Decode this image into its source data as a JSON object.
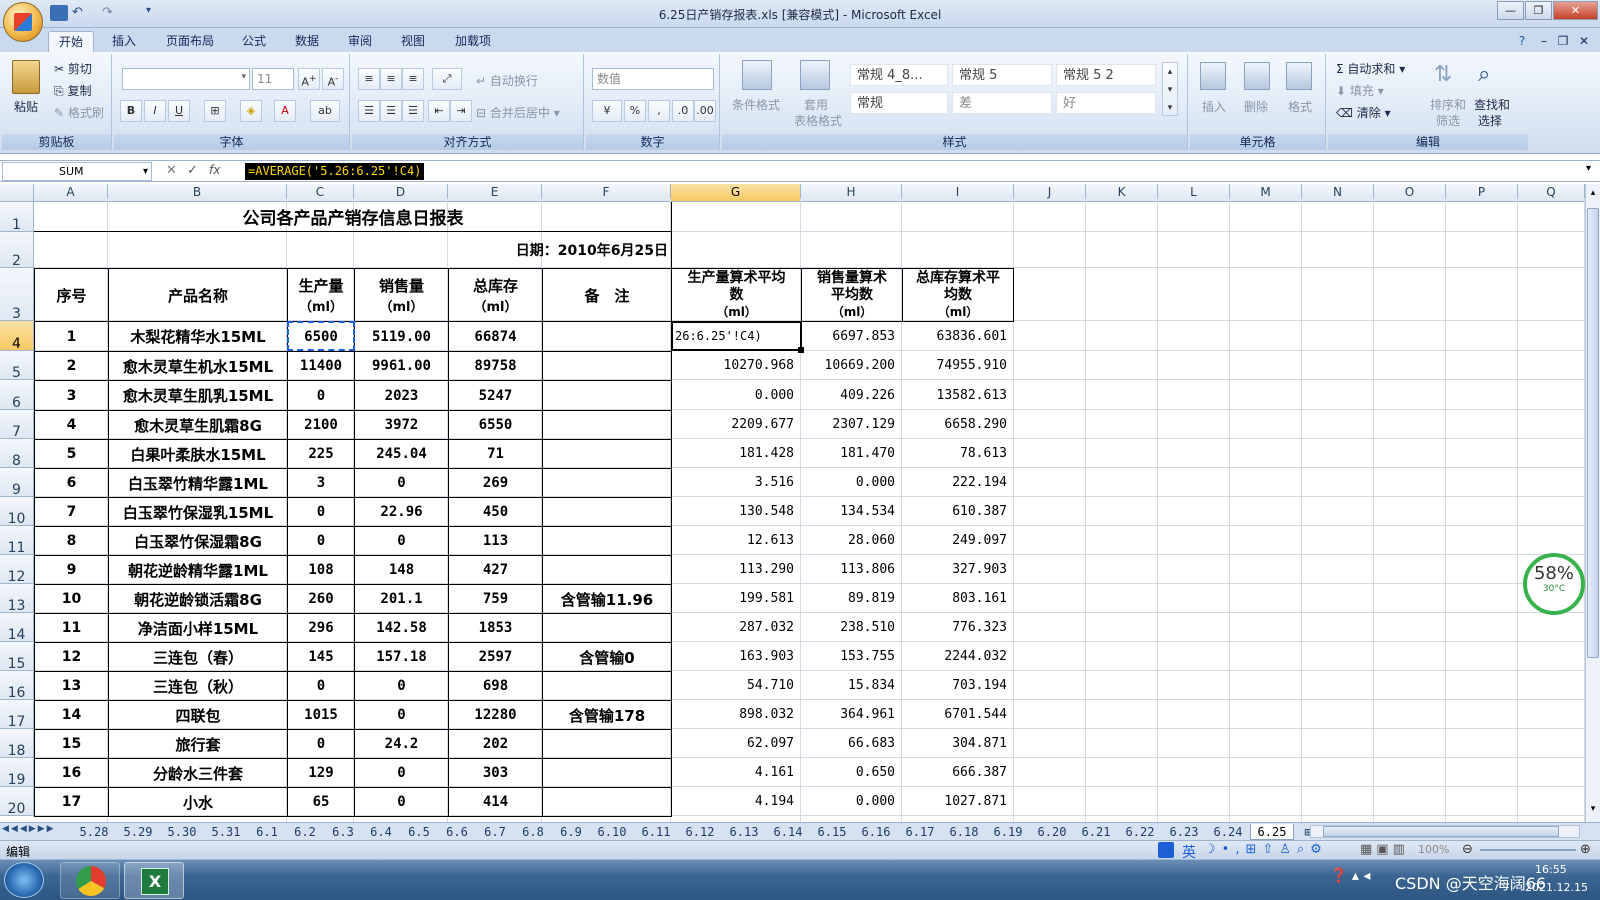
{
  "window": {
    "title": "6.25日产销存报表.xls  [兼容模式] - Microsoft Excel"
  },
  "ribbon_tabs": [
    "开始",
    "插入",
    "页面布局",
    "公式",
    "数据",
    "审阅",
    "视图",
    "加载项"
  ],
  "ribbon": {
    "clipboard": {
      "paste": "粘贴",
      "cut": "剪切",
      "copy": "复制",
      "format_painter": "格式刷",
      "label": "剪贴板"
    },
    "font": {
      "size": "11",
      "label": "字体"
    },
    "alignment": {
      "wrap": "自动换行",
      "merge": "合并后居中",
      "label": "对齐方式"
    },
    "number": {
      "format": "数值",
      "label": "数字"
    },
    "styles": {
      "conditional": "条件格式",
      "table1": "套用",
      "table2": "表格格式",
      "cells": [
        "常规 4_8...",
        "常规 5",
        "常规 5 2",
        "常规",
        "差",
        "好"
      ],
      "label": "样式"
    },
    "cells": {
      "insert": "插入",
      "delete": "删除",
      "format": "格式",
      "label": "单元格"
    },
    "editing": {
      "autosum": "自动求和",
      "fill": "填充",
      "clear": "清除",
      "sort1": "排序和",
      "sort2": "筛选",
      "find1": "查找和",
      "find2": "选择",
      "label": "编辑"
    }
  },
  "formula_bar": {
    "name_box": "SUM",
    "formula": "=AVERAGE('5.26:6.25'!C4)"
  },
  "columns": [
    "A",
    "B",
    "C",
    "D",
    "E",
    "F",
    "G",
    "H",
    "I",
    "J",
    "K",
    "L",
    "M",
    "N",
    "O",
    "P",
    "Q"
  ],
  "rows": [
    "1",
    "2",
    "3",
    "4",
    "5",
    "6",
    "7",
    "8",
    "9",
    "10",
    "11",
    "12",
    "13",
    "14",
    "15",
    "16",
    "17",
    "18",
    "19",
    "20"
  ],
  "sheet": {
    "title": "公司各产品产销存信息日报表",
    "date": "日期：2010年6月25日",
    "headers": {
      "no": "序号",
      "name": "产品名称",
      "prod1": "生产量",
      "prod2": "（ml）",
      "sales1": "销售量",
      "sales2": "（ml）",
      "stock1": "总库存",
      "stock2": "（ml）",
      "note": "备　注",
      "g1": "生产量算术平均",
      "g2": "数",
      "g3": "（ml）",
      "h1": "销售量算术",
      "h2": "平均数",
      "h3": "（ml）",
      "i1": "总库存算术平",
      "i2": "均数",
      "i3": "（ml）"
    },
    "editing_text": "26:6.25'!C4)",
    "rows": [
      [
        "1",
        "木梨花精华水15ML",
        "6500",
        "5119.00",
        "66874",
        "",
        "",
        "6697.853",
        "63836.601"
      ],
      [
        "2",
        "愈木灵草生机水15ML",
        "11400",
        "9961.00",
        "89758",
        "",
        "10270.968",
        "10669.200",
        "74955.910"
      ],
      [
        "3",
        "愈木灵草生肌乳15ML",
        "0",
        "2023",
        "5247",
        "",
        "0.000",
        "409.226",
        "13582.613"
      ],
      [
        "4",
        "愈木灵草生肌霜8G",
        "2100",
        "3972",
        "6550",
        "",
        "2209.677",
        "2307.129",
        "6658.290"
      ],
      [
        "5",
        "白果叶柔肤水15ML",
        "225",
        "245.04",
        "71",
        "",
        "181.428",
        "181.470",
        "78.613"
      ],
      [
        "6",
        "白玉翠竹精华露1ML",
        "3",
        "0",
        "269",
        "",
        "3.516",
        "0.000",
        "222.194"
      ],
      [
        "7",
        "白玉翠竹保湿乳15ML",
        "0",
        "22.96",
        "450",
        "",
        "130.548",
        "134.534",
        "610.387"
      ],
      [
        "8",
        "白玉翠竹保湿霜8G",
        "0",
        "0",
        "113",
        "",
        "12.613",
        "28.060",
        "249.097"
      ],
      [
        "9",
        "朝花逆龄精华露1ML",
        "108",
        "148",
        "427",
        "",
        "113.290",
        "113.806",
        "327.903"
      ],
      [
        "10",
        "朝花逆龄锁活霜8G",
        "260",
        "201.1",
        "759",
        "含管输11.96",
        "199.581",
        "89.819",
        "803.161"
      ],
      [
        "11",
        "净洁面小样15ML",
        "296",
        "142.58",
        "1853",
        "",
        "287.032",
        "238.510",
        "776.323"
      ],
      [
        "12",
        "三连包（春）",
        "145",
        "157.18",
        "2597",
        "含管输0",
        "163.903",
        "153.755",
        "2244.032"
      ],
      [
        "13",
        "三连包（秋）",
        "0",
        "0",
        "698",
        "",
        "54.710",
        "15.834",
        "703.194"
      ],
      [
        "14",
        "四联包",
        "1015",
        "0",
        "12280",
        "含管输178",
        "898.032",
        "364.961",
        "6701.544"
      ],
      [
        "15",
        "旅行套",
        "0",
        "24.2",
        "202",
        "",
        "62.097",
        "66.683",
        "304.871"
      ],
      [
        "16",
        "分龄水三件套",
        "129",
        "0",
        "303",
        "",
        "4.161",
        "0.650",
        "666.387"
      ],
      [
        "17",
        "小水",
        "65",
        "0",
        "414",
        "",
        "4.194",
        "0.000",
        "1027.871"
      ]
    ]
  },
  "sheet_tabs": [
    "5.28",
    "5.29",
    "5.30",
    "5.31",
    "6.1",
    "6.2",
    "6.3",
    "6.4",
    "6.5",
    "6.6",
    "6.7",
    "6.8",
    "6.9",
    "6.10",
    "6.11",
    "6.12",
    "6.13",
    "6.14",
    "6.15",
    "6.16",
    "6.17",
    "6.18",
    "6.19",
    "6.20",
    "6.21",
    "6.22",
    "6.23",
    "6.24",
    "6.25"
  ],
  "active_sheet": "6.25",
  "status": {
    "mode": "编辑",
    "zoom": "100%",
    "ime": "英"
  },
  "widget": {
    "cpu": "58%",
    "temp": "30°C"
  },
  "taskbar": {
    "time": "16:55",
    "date": "2021.12.15",
    "tray_text": "CSDN @天空海阔66"
  }
}
